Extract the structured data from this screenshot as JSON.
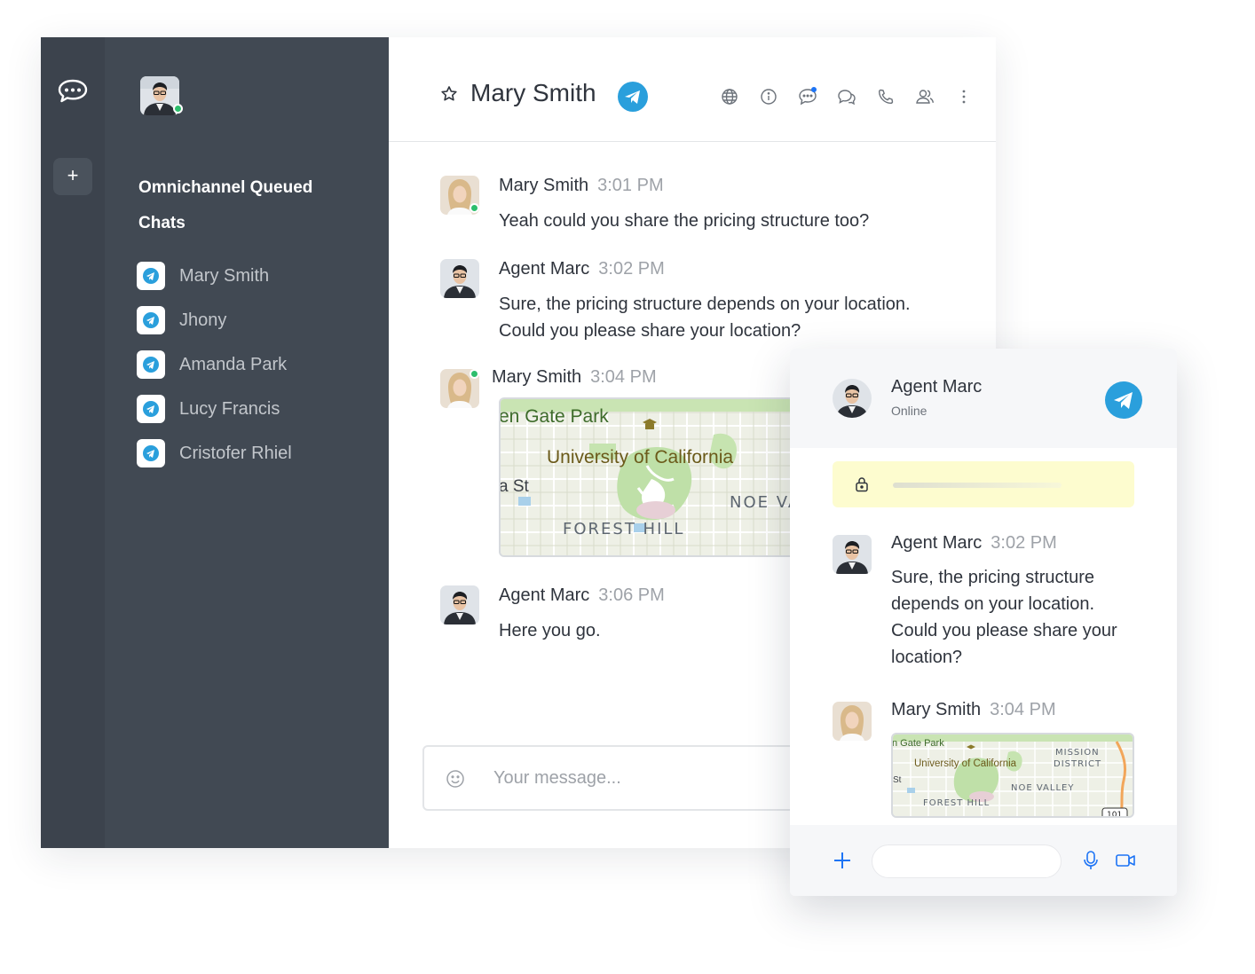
{
  "sidebar": {
    "title": "Omnichannel Queued Chats",
    "chats": [
      {
        "name": "Mary Smith"
      },
      {
        "name": "Jhony"
      },
      {
        "name": "Amanda Park"
      },
      {
        "name": "Lucy Francis"
      },
      {
        "name": "Cristofer Rhiel"
      }
    ]
  },
  "header": {
    "title": "Mary Smith"
  },
  "messages": [
    {
      "author": "Mary Smith",
      "time": "3:01 PM",
      "text": "Yeah could you share the pricing structure too?"
    },
    {
      "author": "Agent Marc",
      "time": "3:02 PM",
      "text_line1": "Sure, the pricing structure depends on your location.",
      "text_line2": "Could you please share your location?"
    },
    {
      "author": "Mary Smith",
      "time": "3:04 PM"
    },
    {
      "author": "Agent Marc",
      "time": "3:06 PM",
      "text": "Here you go."
    }
  ],
  "map": {
    "label_park": "en Gate Park",
    "label_university": "University of California",
    "label_st": "a St",
    "label_noe": "NOE VA",
    "label_forest": "FOREST HILL"
  },
  "composer": {
    "placeholder": "Your message..."
  },
  "popup": {
    "name": "Agent Marc",
    "status": "Online",
    "msg1": {
      "author": "Agent Marc",
      "time": "3:02 PM",
      "l1": "Sure, the pricing structure",
      "l2": "depends on your location.",
      "l3": "Could you please share your",
      "l4": "location?"
    },
    "msg2": {
      "author": "Mary Smith",
      "time": "3:04 PM"
    },
    "map": {
      "label_park": "n Gate Park",
      "label_university": "University of California",
      "label_st": "St",
      "label_mission1": "MISSION",
      "label_mission2": "DISTRICT",
      "label_noe": "NOE VALLEY",
      "label_forest": "FOREST HILL",
      "label_hwy": "101"
    }
  },
  "colors": {
    "accent": "#2a9fdc",
    "online": "#2dbe6c",
    "sidebar": "#414953",
    "e2e": "#fdfccf"
  }
}
